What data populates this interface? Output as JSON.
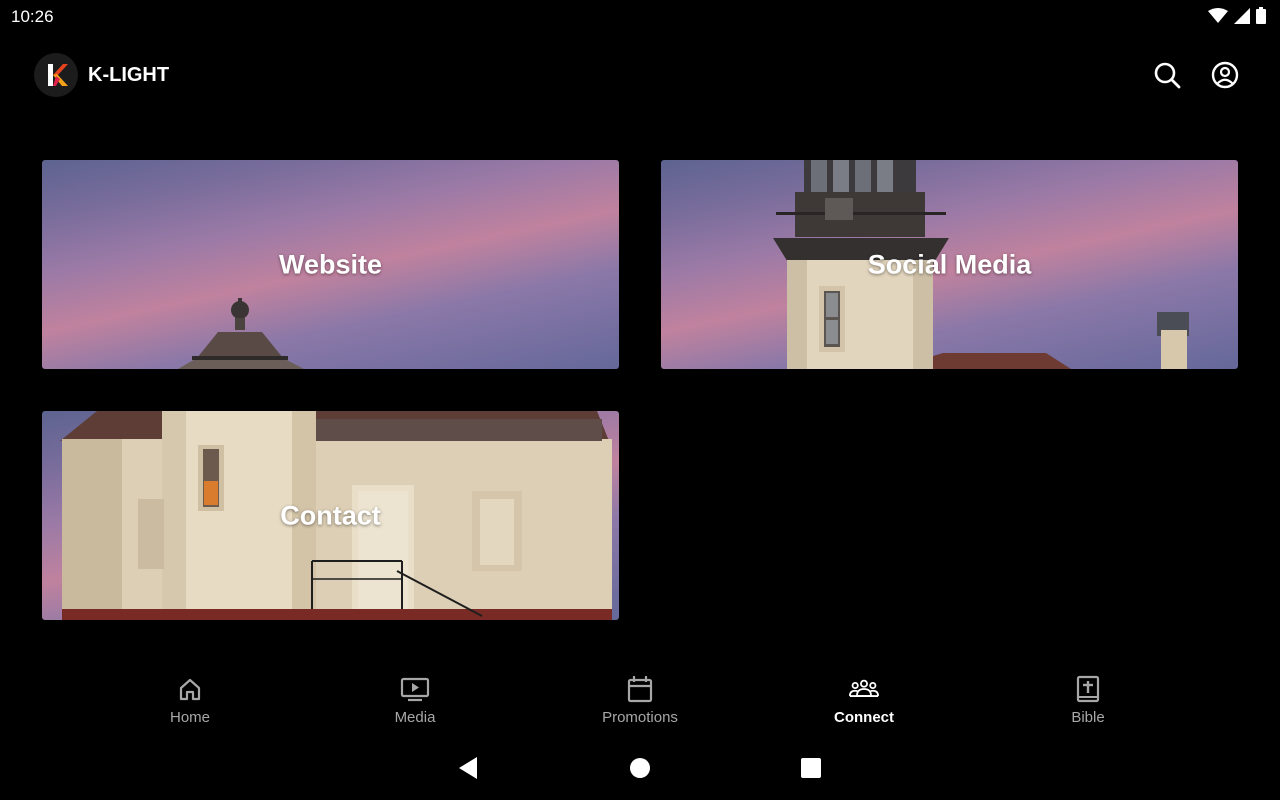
{
  "status_bar": {
    "time": "10:26",
    "icons": [
      "wifi-icon",
      "signal-icon",
      "battery-icon"
    ]
  },
  "app_bar": {
    "logo_letter": "K",
    "title": "K-LIGHT",
    "actions": [
      "search-icon",
      "account-icon"
    ]
  },
  "cards": {
    "website": "Website",
    "social": "Social Media",
    "contact": "Contact"
  },
  "bottom_nav": {
    "items": [
      {
        "label": "Home",
        "icon": "home-icon"
      },
      {
        "label": "Media",
        "icon": "media-icon"
      },
      {
        "label": "Promotions",
        "icon": "calendar-icon"
      },
      {
        "label": "Connect",
        "icon": "group-icon",
        "active": true
      },
      {
        "label": "Bible",
        "icon": "bible-icon"
      }
    ]
  },
  "system_nav": [
    "back-icon",
    "home-circle-icon",
    "recents-icon"
  ],
  "colors": {
    "background": "#000000",
    "inactive_nav": "#a7a7a7",
    "active_nav": "#ffffff"
  }
}
